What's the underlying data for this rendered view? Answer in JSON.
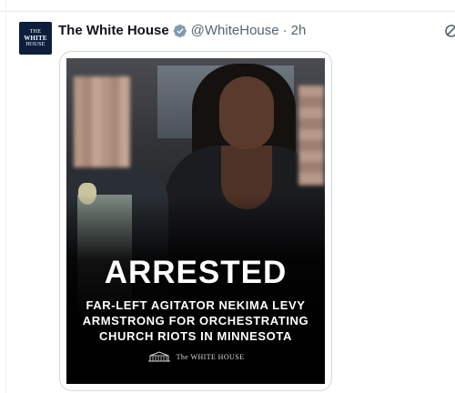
{
  "post": {
    "display_name": "The White House",
    "handle": "@WhiteHouse",
    "separator": "·",
    "time": "2h",
    "avatar": {
      "line1": "THE",
      "line2": "WHITE",
      "line3": "HOUSE"
    }
  },
  "media": {
    "headline": "ARRESTED",
    "subline1": "FAR-LEFT AGITATOR NEKIMA LEVY",
    "subline2": "ARMSTRONG FOR ORCHESTRATING",
    "subline3": "CHURCH RIOTS IN MINNESOTA",
    "brand_text": "The WHITE HOUSE"
  },
  "icons": {
    "verified": "verified-badge-icon",
    "more": "grok-icon",
    "brand": "white-house-building-icon"
  },
  "colors": {
    "verified": "#829aab",
    "secondary_text": "#536471",
    "avatar_bg": "#0c1e3c",
    "media_text": "#ffffff"
  }
}
